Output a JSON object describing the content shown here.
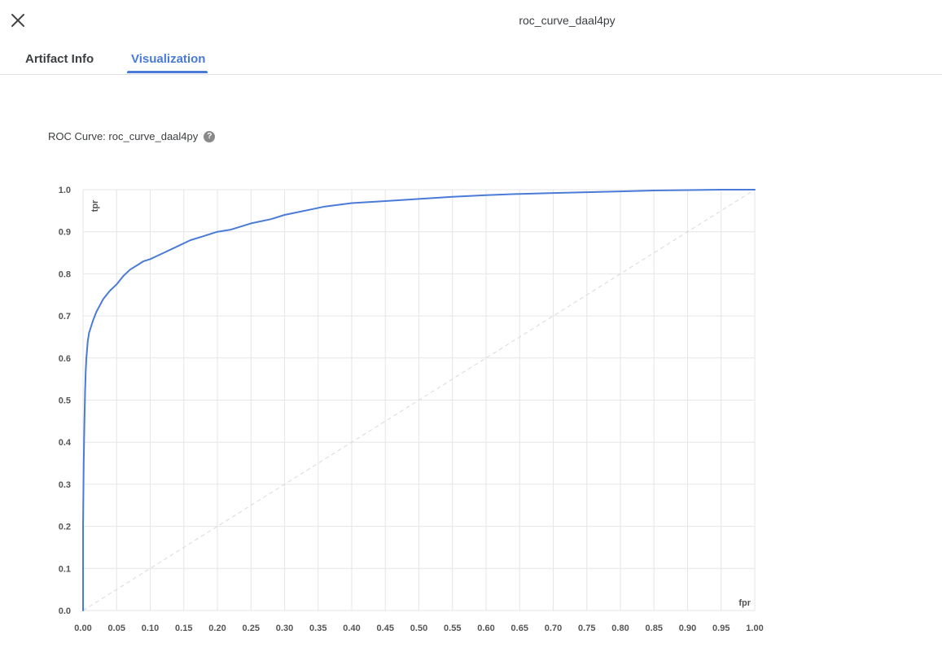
{
  "window": {
    "title": "roc_curve_daal4py",
    "close_icon": "close-icon"
  },
  "tabs": [
    {
      "label": "Artifact Info",
      "active": false
    },
    {
      "label": "Visualization",
      "active": true
    }
  ],
  "visualization": {
    "header_label": "ROC Curve: roc_curve_daal4py",
    "help_icon": "help-circle-icon"
  },
  "colors": {
    "accent": "#4a7bd8",
    "curve": "#4a7bd8",
    "grid": "#e6e6e6",
    "diagonal": "#d9d9d9"
  },
  "chart_data": {
    "type": "line",
    "xlabel": "fpr",
    "ylabel": "tpr",
    "xlim": [
      0,
      1
    ],
    "ylim": [
      0,
      1
    ],
    "grid": true,
    "x_ticks": [
      "0.00",
      "0.05",
      "0.10",
      "0.15",
      "0.20",
      "0.25",
      "0.30",
      "0.35",
      "0.40",
      "0.45",
      "0.50",
      "0.55",
      "0.60",
      "0.65",
      "0.70",
      "0.75",
      "0.80",
      "0.85",
      "0.90",
      "0.95",
      "1.00"
    ],
    "y_ticks": [
      "0.0",
      "0.1",
      "0.2",
      "0.3",
      "0.4",
      "0.5",
      "0.6",
      "0.7",
      "0.8",
      "0.9",
      "1.0"
    ],
    "series": [
      {
        "fpr": [
          0,
          0,
          0.001,
          0.002,
          0.003,
          0.004,
          0.005,
          0.007,
          0.009,
          0.012,
          0.015,
          0.02,
          0.025,
          0.03,
          0.04,
          0.05,
          0.06,
          0.07,
          0.08,
          0.09,
          0.1,
          0.12,
          0.14,
          0.16,
          0.18,
          0.2,
          0.22,
          0.25,
          0.28,
          0.3,
          0.33,
          0.36,
          0.4,
          0.45,
          0.5,
          0.55,
          0.6,
          0.65,
          0.7,
          0.75,
          0.8,
          0.85,
          0.9,
          0.95,
          1.0
        ],
        "tpr": [
          0,
          0.2,
          0.35,
          0.45,
          0.52,
          0.57,
          0.6,
          0.64,
          0.66,
          0.675,
          0.69,
          0.71,
          0.725,
          0.74,
          0.76,
          0.775,
          0.795,
          0.81,
          0.82,
          0.83,
          0.835,
          0.85,
          0.865,
          0.88,
          0.89,
          0.9,
          0.905,
          0.92,
          0.93,
          0.94,
          0.95,
          0.96,
          0.968,
          0.973,
          0.978,
          0.983,
          0.987,
          0.99,
          0.992,
          0.994,
          0.996,
          0.998,
          0.999,
          1.0,
          1.0
        ]
      },
      {
        "fpr": [
          0,
          1
        ],
        "tpr": [
          0,
          1
        ]
      }
    ]
  }
}
